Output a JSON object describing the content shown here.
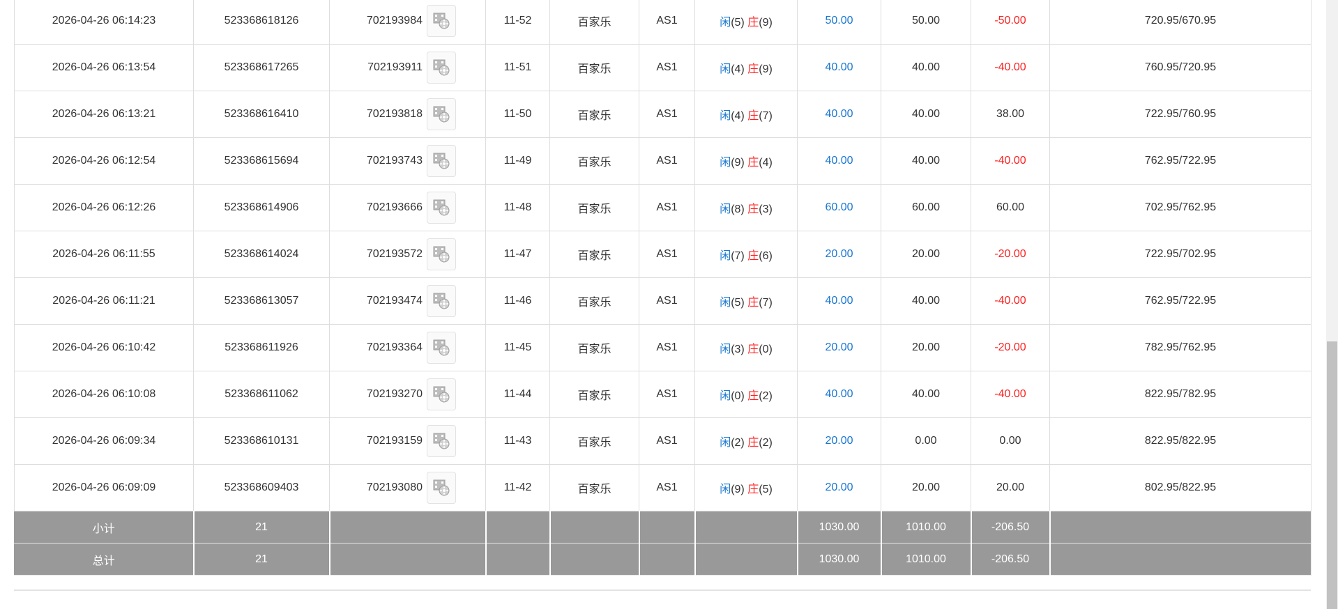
{
  "colors": {
    "player": "#1976d2",
    "banker": "#ff2020",
    "negative": "#ff2020",
    "summary_bg": "#999999"
  },
  "icons": {
    "replay": "film-replay-icon"
  },
  "rows": [
    {
      "time": "2026-04-26 06:14:23",
      "bet_no": "523368618126",
      "game_no": "702193984",
      "round": "11-52",
      "game": "百家乐",
      "table": "AS1",
      "player_label": "闲",
      "player_score": "(5)",
      "banker_label": "庄",
      "banker_score": "(9)",
      "bet": "50.00",
      "valid": "50.00",
      "win": "-50.00",
      "win_negative": true,
      "balance": "720.95/670.95"
    },
    {
      "time": "2026-04-26 06:13:54",
      "bet_no": "523368617265",
      "game_no": "702193911",
      "round": "11-51",
      "game": "百家乐",
      "table": "AS1",
      "player_label": "闲",
      "player_score": "(4)",
      "banker_label": "庄",
      "banker_score": "(9)",
      "bet": "40.00",
      "valid": "40.00",
      "win": "-40.00",
      "win_negative": true,
      "balance": "760.95/720.95"
    },
    {
      "time": "2026-04-26 06:13:21",
      "bet_no": "523368616410",
      "game_no": "702193818",
      "round": "11-50",
      "game": "百家乐",
      "table": "AS1",
      "player_label": "闲",
      "player_score": "(4)",
      "banker_label": "庄",
      "banker_score": "(7)",
      "bet": "40.00",
      "valid": "40.00",
      "win": "38.00",
      "win_negative": false,
      "balance": "722.95/760.95"
    },
    {
      "time": "2026-04-26 06:12:54",
      "bet_no": "523368615694",
      "game_no": "702193743",
      "round": "11-49",
      "game": "百家乐",
      "table": "AS1",
      "player_label": "闲",
      "player_score": "(9)",
      "banker_label": "庄",
      "banker_score": "(4)",
      "bet": "40.00",
      "valid": "40.00",
      "win": "-40.00",
      "win_negative": true,
      "balance": "762.95/722.95"
    },
    {
      "time": "2026-04-26 06:12:26",
      "bet_no": "523368614906",
      "game_no": "702193666",
      "round": "11-48",
      "game": "百家乐",
      "table": "AS1",
      "player_label": "闲",
      "player_score": "(8)",
      "banker_label": "庄",
      "banker_score": "(3)",
      "bet": "60.00",
      "valid": "60.00",
      "win": "60.00",
      "win_negative": false,
      "balance": "702.95/762.95"
    },
    {
      "time": "2026-04-26 06:11:55",
      "bet_no": "523368614024",
      "game_no": "702193572",
      "round": "11-47",
      "game": "百家乐",
      "table": "AS1",
      "player_label": "闲",
      "player_score": "(7)",
      "banker_label": "庄",
      "banker_score": "(6)",
      "bet": "20.00",
      "valid": "20.00",
      "win": "-20.00",
      "win_negative": true,
      "balance": "722.95/702.95"
    },
    {
      "time": "2026-04-26 06:11:21",
      "bet_no": "523368613057",
      "game_no": "702193474",
      "round": "11-46",
      "game": "百家乐",
      "table": "AS1",
      "player_label": "闲",
      "player_score": "(5)",
      "banker_label": "庄",
      "banker_score": "(7)",
      "bet": "40.00",
      "valid": "40.00",
      "win": "-40.00",
      "win_negative": true,
      "balance": "762.95/722.95"
    },
    {
      "time": "2026-04-26 06:10:42",
      "bet_no": "523368611926",
      "game_no": "702193364",
      "round": "11-45",
      "game": "百家乐",
      "table": "AS1",
      "player_label": "闲",
      "player_score": "(3)",
      "banker_label": "庄",
      "banker_score": "(0)",
      "bet": "20.00",
      "valid": "20.00",
      "win": "-20.00",
      "win_negative": true,
      "balance": "782.95/762.95"
    },
    {
      "time": "2026-04-26 06:10:08",
      "bet_no": "523368611062",
      "game_no": "702193270",
      "round": "11-44",
      "game": "百家乐",
      "table": "AS1",
      "player_label": "闲",
      "player_score": "(0)",
      "banker_label": "庄",
      "banker_score": "(2)",
      "bet": "40.00",
      "valid": "40.00",
      "win": "-40.00",
      "win_negative": true,
      "balance": "822.95/782.95"
    },
    {
      "time": "2026-04-26 06:09:34",
      "bet_no": "523368610131",
      "game_no": "702193159",
      "round": "11-43",
      "game": "百家乐",
      "table": "AS1",
      "player_label": "闲",
      "player_score": "(2)",
      "banker_label": "庄",
      "banker_score": "(2)",
      "bet": "20.00",
      "valid": "0.00",
      "win": "0.00",
      "win_negative": false,
      "balance": "822.95/822.95"
    },
    {
      "time": "2026-04-26 06:09:09",
      "bet_no": "523368609403",
      "game_no": "702193080",
      "round": "11-42",
      "game": "百家乐",
      "table": "AS1",
      "player_label": "闲",
      "player_score": "(9)",
      "banker_label": "庄",
      "banker_score": "(5)",
      "bet": "20.00",
      "valid": "20.00",
      "win": "20.00",
      "win_negative": false,
      "balance": "802.95/822.95"
    }
  ],
  "subtotal": {
    "label": "小计",
    "count": "21",
    "bet": "1030.00",
    "valid": "1010.00",
    "win": "-206.50"
  },
  "total": {
    "label": "总计",
    "count": "21",
    "bet": "1030.00",
    "valid": "1010.00",
    "win": "-206.50"
  }
}
